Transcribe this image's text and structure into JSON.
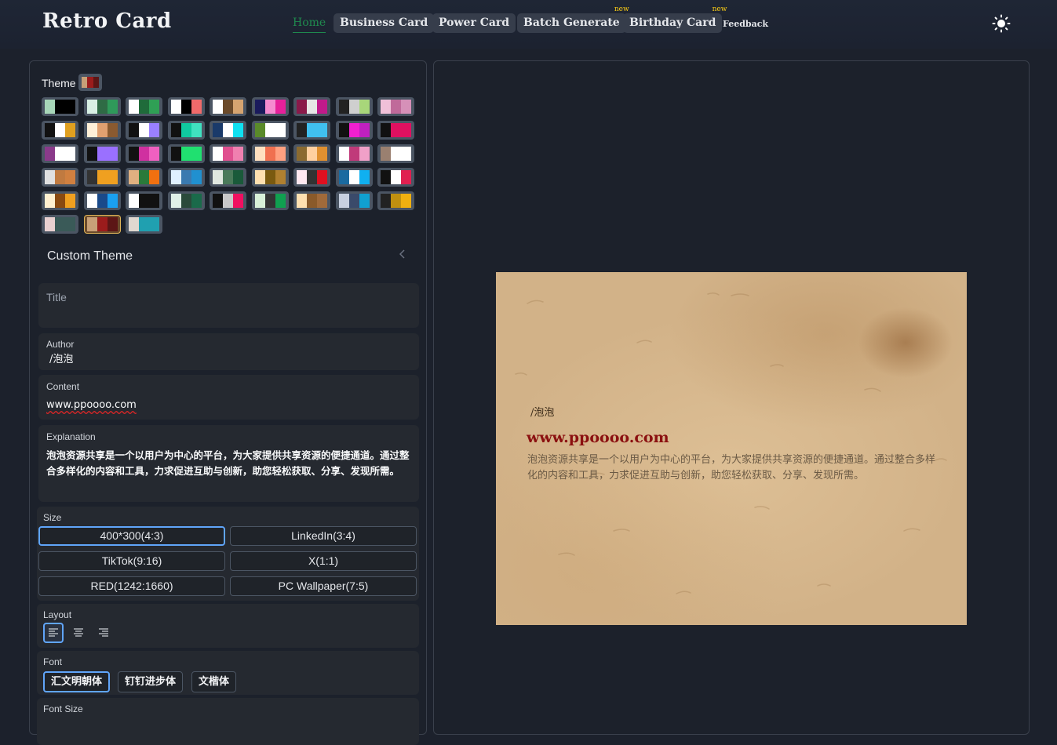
{
  "brand": "Retro Card",
  "nav": {
    "home": "Home",
    "business_card": "Business Card",
    "power_card": "Power Card",
    "batch_generate": "Batch Generate",
    "birthday_card": "Birthday Card",
    "feedback": "Feedback",
    "new_badge": "new"
  },
  "theme_toggle_icon": "sun-icon",
  "left": {
    "theme_label": "Theme",
    "current_theme": [
      "#c8a077",
      "#9b1c1c",
      "#5c1616"
    ],
    "themes": [
      [
        "#a7d6b8",
        "#000000",
        "#000000"
      ],
      [
        "#d8f0e4",
        "#2f6b45",
        "#2f9a5a"
      ],
      [
        "#ffffff",
        "#1f6b3a",
        "#2fa055"
      ],
      [
        "#ffffff",
        "#000000",
        "#f06a6a"
      ],
      [
        "#ffffff",
        "#6b4a2a",
        "#d6a470"
      ],
      [
        "#1a1a5c",
        "#f58ad0",
        "#e6209a"
      ],
      [
        "#8a1a4a",
        "#e6e6e6",
        "#c01a8a"
      ],
      [
        "#222222",
        "#cfcfcf",
        "#a8d67a"
      ],
      [
        "#f0c0d8",
        "#c06a9a",
        "#d690b8"
      ],
      [
        "#111111",
        "#ffffff",
        "#e0a020"
      ],
      [
        "#fff0d8",
        "#e0a070",
        "#8a5a30"
      ],
      [
        "#111111",
        "#ffffff",
        "#9a80ff"
      ],
      [
        "#111111",
        "#10c9a0",
        "#40e0c0"
      ],
      [
        "#1a3a6a",
        "#ffffff",
        "#10e0f0"
      ],
      [
        "#5a8a2a",
        "#ffffff",
        "#ffffff"
      ],
      [
        "#222222",
        "#40c0f0",
        "#40c0f0"
      ],
      [
        "#111111",
        "#f020d0",
        "#c020c0"
      ],
      [
        "#111111",
        "#e01060",
        "#e01060"
      ],
      [
        "#8a3a8a",
        "#ffffff",
        "#ffffff"
      ],
      [
        "#111111",
        "#9a70ff",
        "#9a70ff"
      ],
      [
        "#111111",
        "#d030a0",
        "#f060c0"
      ],
      [
        "#111111",
        "#20e070",
        "#20e070"
      ],
      [
        "#ffffff",
        "#e05090",
        "#f080b0"
      ],
      [
        "#ffe0c0",
        "#f07050",
        "#ffa080"
      ],
      [
        "#8a6a30",
        "#ffd0a0",
        "#e09030"
      ],
      [
        "#ffffff",
        "#c03a7a",
        "#f0a0c8"
      ],
      [
        "#9a8070",
        "#ffffff",
        "#ffffff"
      ],
      [
        "#e0e0e0",
        "#c07a40",
        "#d08040"
      ],
      [
        "#333333",
        "#f0a020",
        "#f0a020"
      ],
      [
        "#e0b080",
        "#2a7a3a",
        "#f07010"
      ],
      [
        "#e0f0ff",
        "#3a7ab0",
        "#2090d0"
      ],
      [
        "#e0e8e0",
        "#4a7a5a",
        "#1a5a3a"
      ],
      [
        "#ffe0b0",
        "#7a5a10",
        "#b08030"
      ],
      [
        "#ffe8f0",
        "#333333",
        "#e01020"
      ],
      [
        "#1a6aa0",
        "#ffffff",
        "#10b0f0"
      ],
      [
        "#111111",
        "#ffffff",
        "#e02050"
      ],
      [
        "#fff0d0",
        "#8a4a10",
        "#f0a020"
      ],
      [
        "#ffffff",
        "#1a4a8a",
        "#1aa0f0"
      ],
      [
        "#ffffff",
        "#111111",
        "#111111"
      ],
      [
        "#e0f0e8",
        "#2a4a3a",
        "#1a6a4a"
      ],
      [
        "#111111",
        "#c8c8c8",
        "#f01060"
      ],
      [
        "#d8f0d8",
        "#333333",
        "#10a050"
      ],
      [
        "#ffe0b0",
        "#8a5a2a",
        "#a06a3a"
      ],
      [
        "#c8d0e0",
        "#3a4a6a",
        "#10a0d0"
      ],
      [
        "#222222",
        "#c09010",
        "#f0b010"
      ],
      [
        "#e8d0d0",
        "#3a5a58",
        "#3a5a58"
      ],
      [
        "#c8a077",
        "#9b1c1c",
        "#5c1616"
      ],
      [
        "#e0d8d0",
        "#20a0b0",
        "#20a0b0"
      ]
    ],
    "custom_theme_label": "Custom Theme",
    "title_field": {
      "placeholder": "Title"
    },
    "author_field": {
      "label": "Author",
      "value": "/泡泡"
    },
    "content_field": {
      "label": "Content",
      "value": "www.ppoooo.com"
    },
    "explanation_field": {
      "label": "Explanation",
      "value": "泡泡资源共享是一个以用户为中心的平台，为大家提供共享资源的便捷通道。通过整合多样化的内容和工具，力求促进互助与创新，助您轻松获取、分享、发现所需。"
    },
    "size": {
      "label": "Size",
      "options": [
        "400*300(4:3)",
        "LinkedIn(3:4)",
        "TikTok(9:16)",
        "X(1:1)",
        "RED(1242:1660)",
        "PC Wallpaper(7:5)"
      ],
      "selected": "400*300(4:3)"
    },
    "layout": {
      "label": "Layout",
      "options": [
        "align-left-icon",
        "align-center-icon",
        "align-right-icon"
      ],
      "selected": "align-left-icon"
    },
    "font": {
      "label": "Font",
      "options": [
        "汇文明朝体",
        "钉钉进步体",
        "文楷体"
      ],
      "selected": "汇文明朝体"
    },
    "font_size": {
      "label": "Font Size"
    }
  },
  "preview": {
    "author": "/泡泡",
    "content": "www.ppoooo.com",
    "explanation": "泡泡资源共享是一个以用户为中心的平台，为大家提供共享资源的便捷通道。通过整合多样化的内容和工具，力求促进互助与创新，助您轻松获取、分享、发现所需。",
    "accent": "#8b1010"
  }
}
